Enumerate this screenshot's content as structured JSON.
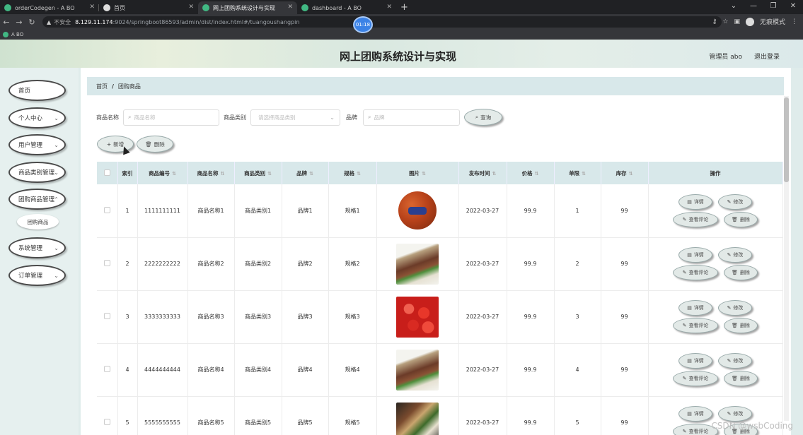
{
  "browser": {
    "tabs": [
      {
        "title": "orderCodegen - A BO",
        "icon_color": "#41b883",
        "active": false
      },
      {
        "title": "首页",
        "icon_color": "#dddddd",
        "active": false
      },
      {
        "title": "网上团购系统设计与实现",
        "icon_color": "#41b883",
        "active": true
      },
      {
        "title": "dashboard - A BO",
        "icon_color": "#41b883",
        "active": false
      }
    ],
    "new_tab_label": "+",
    "insecure_label": "不安全",
    "url_host": "8.129.11.174",
    "url_path": ":9024/springboot86593/admin/dist/index.html#/tuangoushangpin",
    "incognito_label": "无痕模式",
    "bookmark": "A BO",
    "timer": "01:18"
  },
  "header": {
    "title": "网上团购系统设计与实现",
    "user_label": "管理员 abo",
    "logout_label": "退出登录"
  },
  "sidebar": {
    "items": [
      {
        "label": "首页",
        "has_chevron": false
      },
      {
        "label": "个人中心",
        "has_chevron": true
      },
      {
        "label": "用户管理",
        "has_chevron": true
      },
      {
        "label": "商品类别管理",
        "has_chevron": true
      },
      {
        "label": "团购商品管理",
        "has_chevron": true
      },
      {
        "label": "系统管理",
        "has_chevron": true
      },
      {
        "label": "订单管理",
        "has_chevron": true
      }
    ],
    "sub_item": "团购商品"
  },
  "breadcrumb": {
    "home": "首页",
    "separator": "/",
    "current": "团购商品"
  },
  "filters": {
    "name_label": "商品名称",
    "name_placeholder": "商品名称",
    "category_label": "商品类别",
    "category_placeholder": "请选择商品类别",
    "brand_label": "品牌",
    "brand_placeholder": "品牌",
    "search_button": "查询"
  },
  "actions": {
    "add": "新增",
    "delete": "删除"
  },
  "table": {
    "headers": [
      "",
      "索引",
      "商品编号",
      "商品名称",
      "商品类别",
      "品牌",
      "规格",
      "图片",
      "发布时间",
      "价格",
      "单限",
      "库存",
      "操作"
    ],
    "op_labels": {
      "detail": "详情",
      "edit": "修改",
      "review": "查看评论",
      "delete": "删除"
    },
    "rows": [
      {
        "index": "1",
        "code": "1111111111",
        "name": "商品名称1",
        "category": "商品类别1",
        "brand": "品牌1",
        "spec": "规格1",
        "image": "basketball",
        "date": "2022-03-27",
        "price": "99.9",
        "limit": "1",
        "stock": "99"
      },
      {
        "index": "2",
        "code": "2222222222",
        "name": "商品名称2",
        "category": "商品类别2",
        "brand": "品牌2",
        "spec": "规格2",
        "image": "food1",
        "date": "2022-03-27",
        "price": "99.9",
        "limit": "2",
        "stock": "99"
      },
      {
        "index": "3",
        "code": "3333333333",
        "name": "商品名称3",
        "category": "商品类别3",
        "brand": "品牌3",
        "spec": "规格3",
        "image": "tomato",
        "date": "2022-03-27",
        "price": "99.9",
        "limit": "3",
        "stock": "99"
      },
      {
        "index": "4",
        "code": "4444444444",
        "name": "商品名称4",
        "category": "商品类别4",
        "brand": "品牌4",
        "spec": "规格4",
        "image": "food1",
        "date": "2022-03-27",
        "price": "99.9",
        "limit": "4",
        "stock": "99"
      },
      {
        "index": "5",
        "code": "5555555555",
        "name": "商品名称5",
        "category": "商品类别5",
        "brand": "品牌5",
        "spec": "规格5",
        "image": "food2",
        "date": "2022-03-27",
        "price": "99.9",
        "limit": "5",
        "stock": "99"
      }
    ]
  },
  "watermark": "CSDN @wsbCoding",
  "colors": {
    "header_accent": "#d8e8ea",
    "sidebar_bg": "#e6f0ef"
  }
}
